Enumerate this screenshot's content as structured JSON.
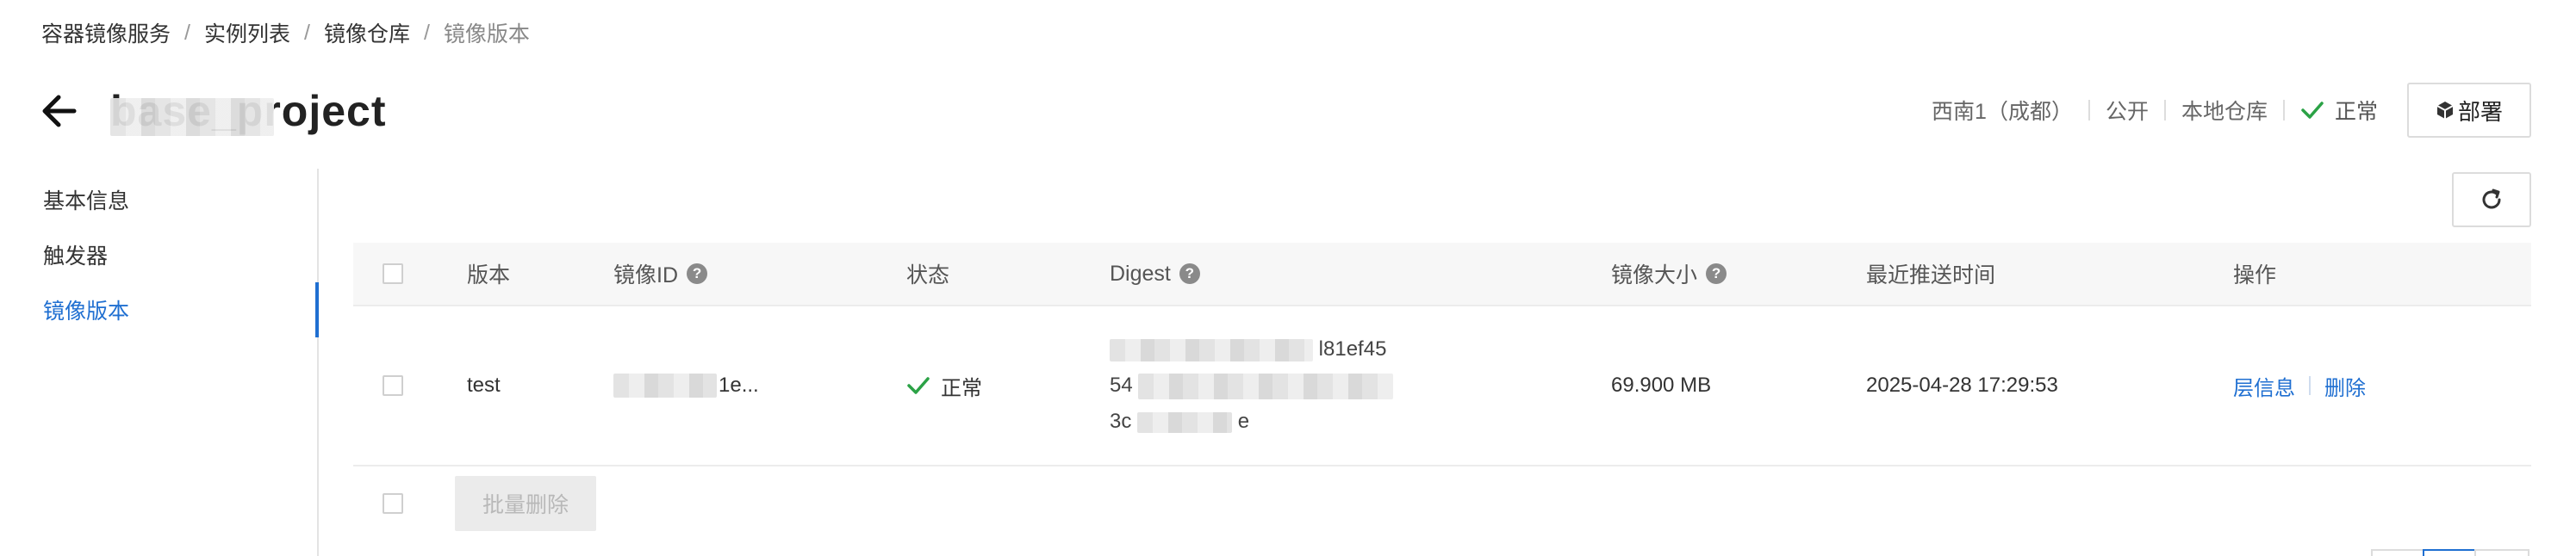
{
  "breadcrumb": {
    "items": [
      "容器镜像服务",
      "实例列表",
      "镜像仓库",
      "镜像版本"
    ],
    "separator": "/"
  },
  "header": {
    "title": "base_project",
    "back_icon": "arrow-left-icon"
  },
  "meta": {
    "region": "西南1（成都）",
    "visibility": "公开",
    "repo_type": "本地仓库",
    "status": "正常",
    "status_color": "#2ba246"
  },
  "actions": {
    "deploy_label": "部署",
    "deploy_icon": "cube-icon",
    "refresh_icon": "refresh-icon"
  },
  "sidebar": {
    "items": [
      {
        "label": "基本信息",
        "active": false
      },
      {
        "label": "触发器",
        "active": false
      },
      {
        "label": "镜像版本",
        "active": true
      }
    ],
    "accent_color": "#1f6fd1"
  },
  "table": {
    "columns": {
      "version": "版本",
      "image_id": "镜像ID",
      "status": "状态",
      "digest": "Digest",
      "size": "镜像大小",
      "last_push": "最近推送时间",
      "ops": "操作"
    },
    "help_glyph": "?",
    "rows": [
      {
        "version": "test",
        "image_id": "1e...",
        "status": "正常",
        "digest_lines": [
          "l81ef45",
          "54",
          "3c"
        ],
        "digest_tail": "e",
        "size": "69.900 MB",
        "last_push": "2025-04-28 17:29:53",
        "ops": [
          "层信息",
          "删除"
        ]
      }
    ]
  },
  "batch": {
    "delete_label": "批量删除"
  }
}
